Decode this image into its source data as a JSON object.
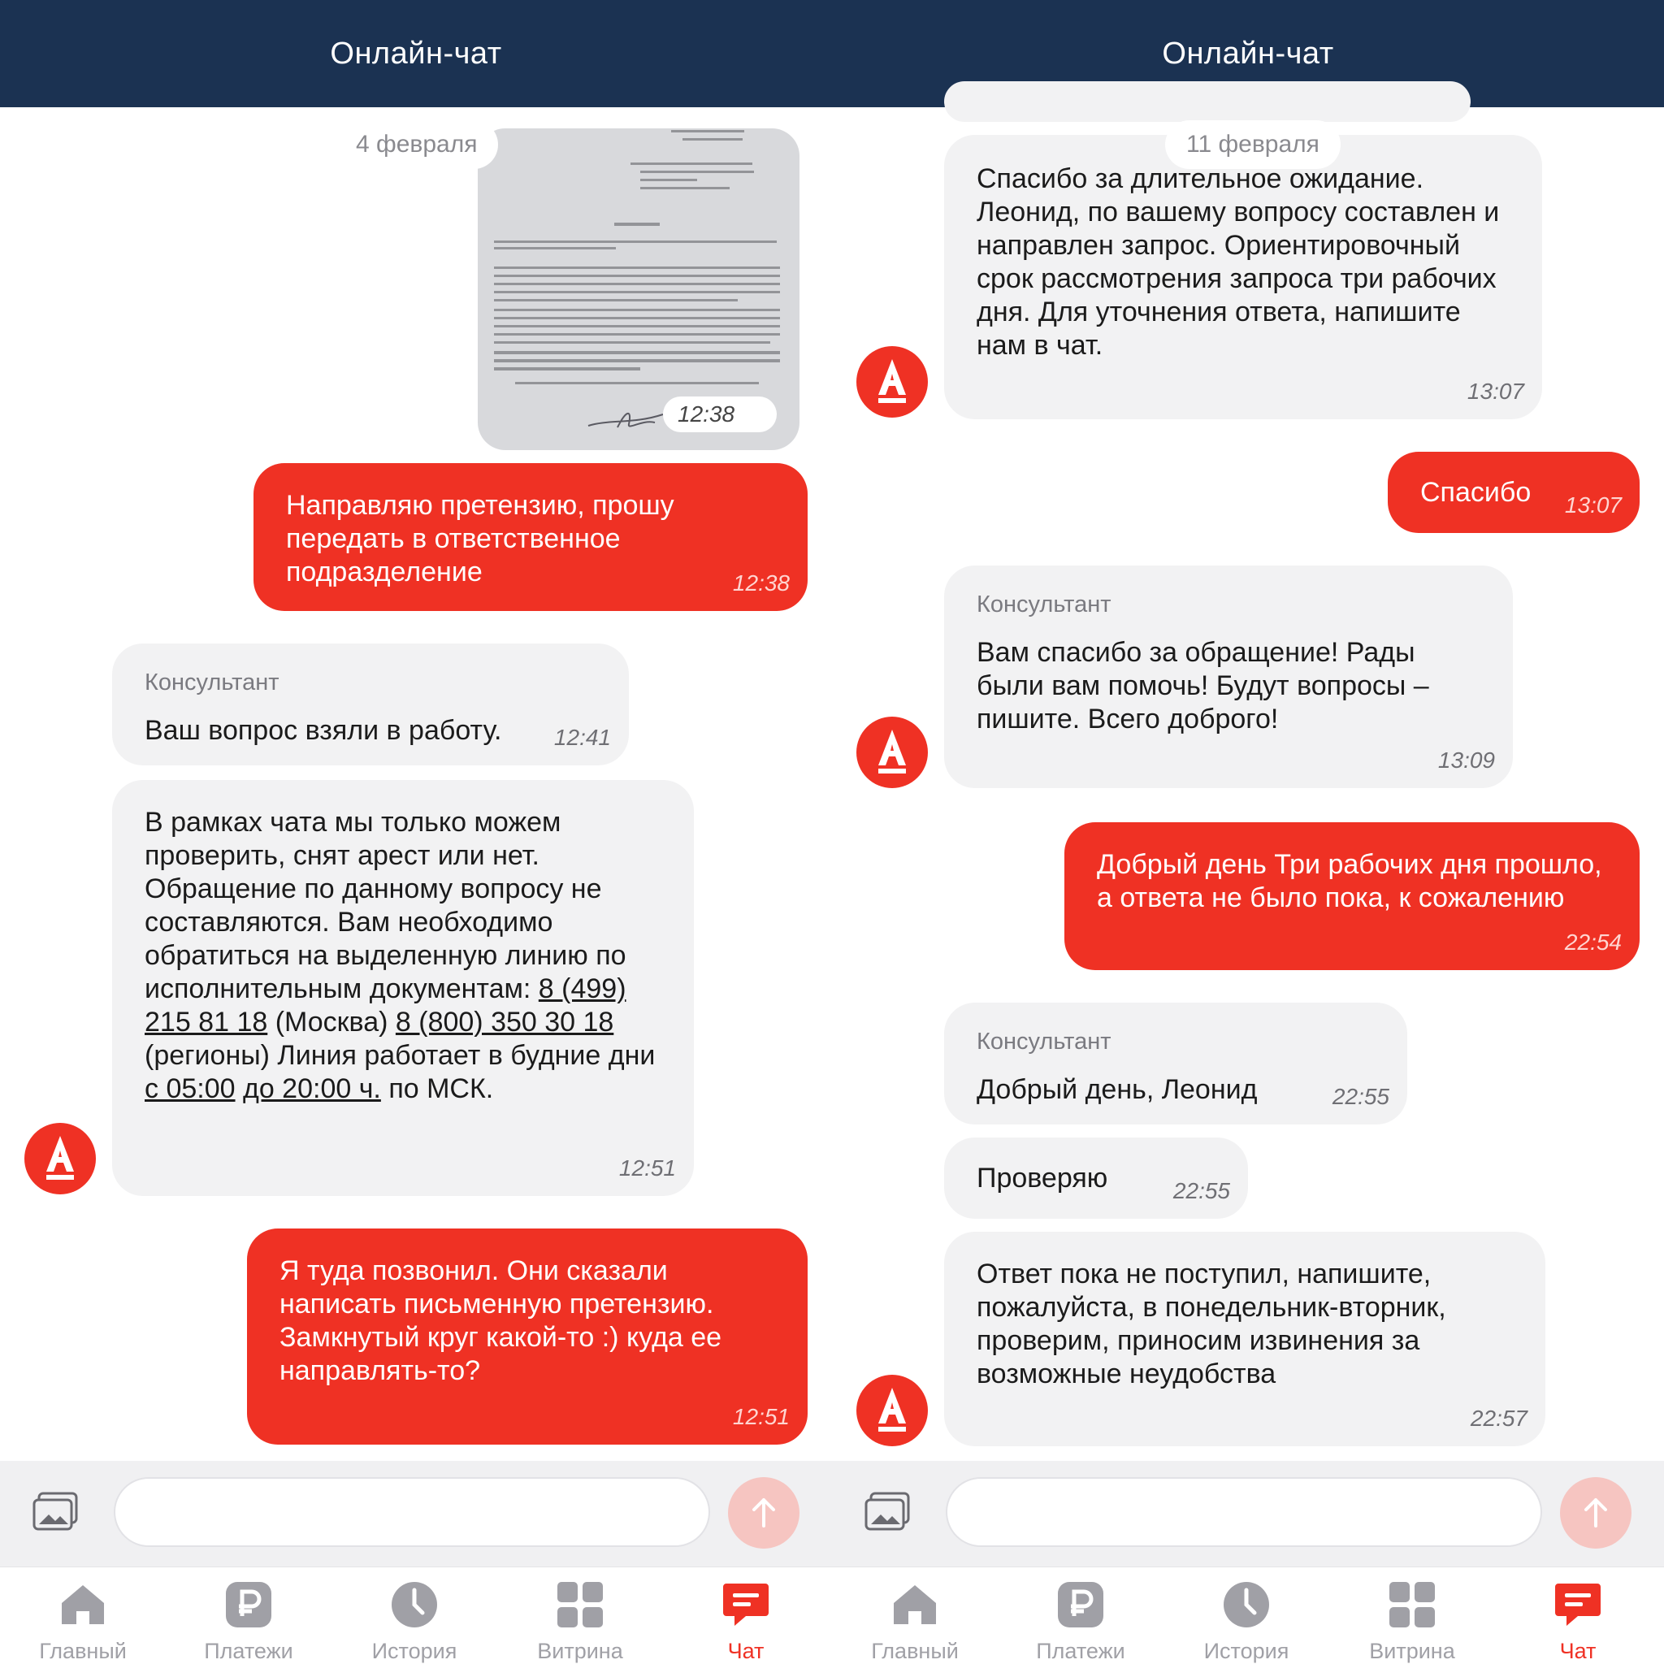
{
  "colors": {
    "header": "#1b3252",
    "accent": "#ef3124",
    "incoming": "#f2f2f3"
  },
  "left": {
    "header_title": "Онлайн-чат",
    "date": "4 февраля",
    "doc_time": "12:38",
    "msgs": {
      "m1": {
        "text": "Направляю претензию, прошу передать в ответственное подразделение",
        "time": "12:38"
      },
      "m2": {
        "sender": "Консультант",
        "text": "Ваш вопрос взяли в работу.",
        "time": "12:41"
      },
      "m3": {
        "t1": "В рамках чата мы только можем проверить, снят арест или нет. Обращение по данному вопросу не составляются. Вам необходимо обратиться на выделенную линию по исполнительным документам: ",
        "phone1": "8 (499) 215 81 18",
        "t2": " (Москва) ",
        "phone2": "8 (800) 350 30 18",
        "t3": " (регионы)   Линия работает в будние дни ",
        "hours1": "с 05:00",
        "t4": " ",
        "hours2": "до 20:00 ч.",
        "t5": " по МСК.",
        "time": "12:51"
      },
      "m4": {
        "text": "Я туда позвонил. Они сказали написать письменную претензию. Замкнутый круг какой-то :) куда ее направлять-то?",
        "time": "12:51"
      }
    }
  },
  "right": {
    "header_title": "Онлайн-чат",
    "date": "11 февраля",
    "msgs": {
      "m1": {
        "text": "Спасибо за длительное ожидание. Леонид, по вашему вопросу составлен и направлен запрос. Ориентировочный срок рассмотрения запроса три рабочих дня. Для уточнения ответа, напишите нам в чат.",
        "time": "13:07"
      },
      "m2": {
        "text": "Спасибо",
        "time": "13:07"
      },
      "m3": {
        "sender": "Консультант",
        "text": "Вам спасибо за обращение! Рады были вам помочь! Будут вопросы – пишите. Всего доброго!",
        "time": "13:09"
      },
      "m4": {
        "text": "Добрый день Три рабочих дня прошло, а ответа не было пока, к сожалению",
        "time": "22:54"
      },
      "m5": {
        "sender": "Консультант",
        "text": "Добрый день, Леонид",
        "time": "22:55"
      },
      "m6": {
        "text": "Проверяю",
        "time": "22:55"
      },
      "m7": {
        "text": "Ответ пока не поступил, напишите, пожалуйста, в понедельник-вторник, проверим, приносим извинения за возможные неудобства",
        "time": "22:57"
      }
    }
  },
  "tabs": [
    {
      "label": "Главный",
      "icon": "home-icon"
    },
    {
      "label": "Платежи",
      "icon": "ruble-icon"
    },
    {
      "label": "История",
      "icon": "clock-icon"
    },
    {
      "label": "Витрина",
      "icon": "grid-icon"
    },
    {
      "label": "Чат",
      "icon": "chat-icon"
    }
  ],
  "avatar_letter": "А"
}
